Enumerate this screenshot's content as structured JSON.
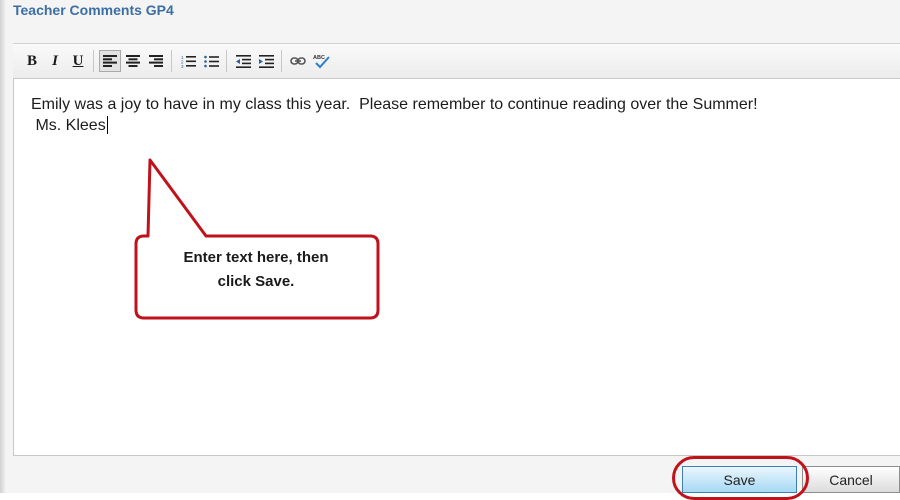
{
  "panel": {
    "title": "Teacher Comments GP4"
  },
  "toolbar": {
    "bold_label": "B",
    "italic_label": "I",
    "underline_label": "U"
  },
  "editor": {
    "line1": "Emily was a joy to have in my class this year.  Please remember to continue reading over the Summer!",
    "line2": " Ms. Klees"
  },
  "callout": {
    "line1": "Enter text here, then",
    "line2": "click Save."
  },
  "buttons": {
    "save_label": "Save",
    "cancel_label": "Cancel"
  },
  "colors": {
    "title": "#3b6ea5",
    "callout_border": "#c0121b",
    "save_bg": "#a7d9f5"
  },
  "icons": [
    "bold-icon",
    "italic-icon",
    "underline-icon",
    "align-left-icon",
    "align-center-icon",
    "align-right-icon",
    "numbered-list-icon",
    "bullet-list-icon",
    "outdent-icon",
    "indent-icon",
    "link-icon",
    "spellcheck-icon"
  ]
}
